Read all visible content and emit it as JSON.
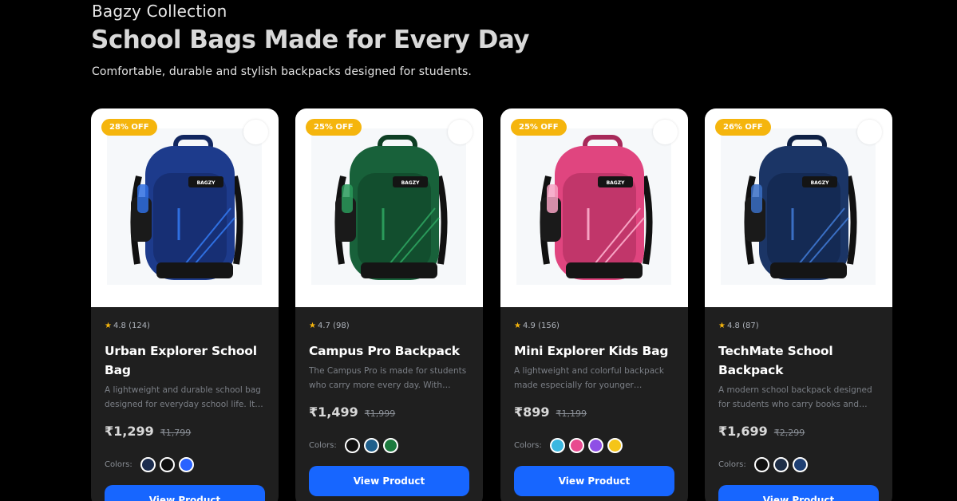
{
  "header": {
    "brand": "Bagzy Collection",
    "headline": "School Bags Made for Every Day",
    "subtitle": "Comfortable, durable and stylish backpacks designed for students."
  },
  "ui": {
    "colors_label": "Colors:",
    "view_button": "View Product",
    "accent": "#1766ff",
    "badge_color": "#f5b50d",
    "star_color": "#f5b50d"
  },
  "products": [
    {
      "discount": "28% OFF",
      "rating": "4.8",
      "reviews": "(124)",
      "title": "Urban Explorer School Bag",
      "description": "A lightweight and durable school bag designed for everyday school life. It…",
      "price": "₹1,299",
      "old_price": "₹1,799",
      "bag_color": "#1d3b8c",
      "bag_dark": "#122760",
      "accent_stripe": "#2f6fe0",
      "colors": [
        "#1c2d4f",
        "#111111",
        "#2962ff"
      ]
    },
    {
      "discount": "25% OFF",
      "rating": "4.7",
      "reviews": "(98)",
      "title": "Campus Pro Backpack",
      "description": "The Campus Pro is made for students who carry more every day. With multipl…",
      "price": "₹1,499",
      "old_price": "₹1,999",
      "bag_color": "#18613a",
      "bag_dark": "#0e3f24",
      "accent_stripe": "#2a9a5a",
      "colors": [
        "#111111",
        "#1f5f8b",
        "#1c7a3e"
      ]
    },
    {
      "discount": "25% OFF",
      "rating": "4.9",
      "reviews": "(156)",
      "title": "Mini Explorer Kids Bag",
      "description": "A lightweight and colorful backpack made especially for younger students…",
      "price": "₹899",
      "old_price": "₹1,199",
      "bag_color": "#e0457f",
      "bag_dark": "#a82a5a",
      "accent_stripe": "#f7a3c3",
      "colors": [
        "#3bb7e0",
        "#e84a8f",
        "#8e4fe6",
        "#f5c518"
      ]
    },
    {
      "discount": "26% OFF",
      "rating": "4.8",
      "reviews": "(87)",
      "title": "TechMate School Backpack",
      "description": "A modern school backpack designed for students who carry books and…",
      "price": "₹1,699",
      "old_price": "₹2,299",
      "bag_color": "#1b3566",
      "bag_dark": "#0f2145",
      "accent_stripe": "#3a6fc4",
      "colors": [
        "#111111",
        "#1e2e47",
        "#1e3f73"
      ]
    }
  ]
}
